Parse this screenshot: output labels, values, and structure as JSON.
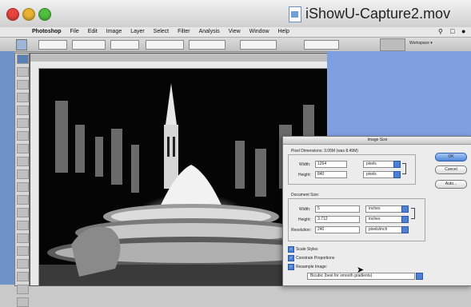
{
  "window": {
    "title": "iShowU-Capture2.mov"
  },
  "menubar": {
    "items": [
      "Photoshop",
      "File",
      "Edit",
      "Image",
      "Layer",
      "Select",
      "Filter",
      "Analysis",
      "View",
      "Window",
      "Help"
    ]
  },
  "options_bar": {
    "workspace_label": "Workspace ▾"
  },
  "dialog": {
    "title": "Image Size",
    "pixel_dimensions_label": "Pixel Dimensions: 3.05M (was 8.49M)",
    "pixel_width": {
      "label": "Width:",
      "value": "1264",
      "unit": "pixels"
    },
    "pixel_height": {
      "label": "Height:",
      "value": "840",
      "unit": "pixels"
    },
    "document_size_label": "Document Size:",
    "doc_width": {
      "label": "Width:",
      "value": "5",
      "unit": "inches"
    },
    "doc_height": {
      "label": "Height:",
      "value": "3.712",
      "unit": "inches"
    },
    "resolution": {
      "label": "Resolution:",
      "value": "240",
      "unit": "pixels/inch"
    },
    "ok_label": "OK",
    "cancel_label": "Cancel",
    "auto_label": "Auto...",
    "scale_styles_label": "Scale Styles",
    "constrain_label": "Constrain Proportions",
    "resample_label": "Resample Image:",
    "resample_method": "Bicubic (best for smooth gradients)"
  }
}
